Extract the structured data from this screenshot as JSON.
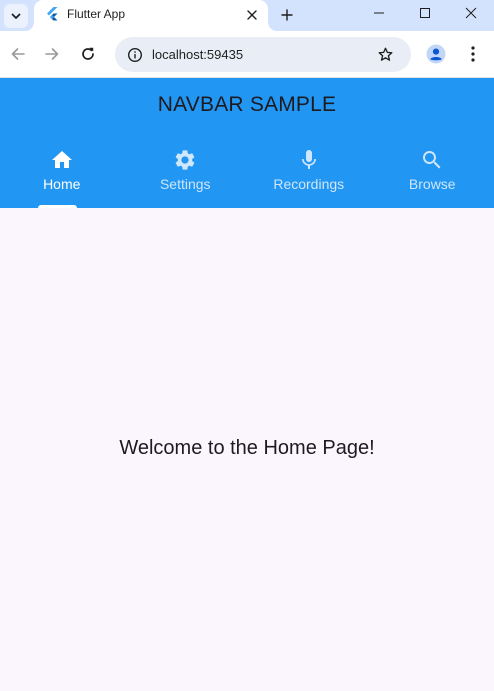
{
  "browser": {
    "tab": {
      "title": "Flutter App"
    },
    "new_tab_symbol": "+",
    "address_bar": {
      "url": "localhost:59435"
    },
    "icons": {
      "tab_search": "chevron-down-icon",
      "favicon": "flutter-logo-icon",
      "tab_close": "close-icon",
      "new_tab": "plus-icon",
      "minimize": "minimize-icon",
      "maximize": "maximize-icon",
      "window_close": "close-icon",
      "back": "arrow-back-icon",
      "forward": "arrow-forward-icon",
      "reload": "reload-icon",
      "site_info": "info-icon",
      "bookmark": "star-icon",
      "profile": "profile-icon",
      "menu": "kebab-menu-icon"
    }
  },
  "appbar": {
    "title": "NAVBAR SAMPLE",
    "background_color": "#2196f3",
    "tabs": [
      {
        "label": "Home",
        "icon": "home-icon",
        "selected": true
      },
      {
        "label": "Settings",
        "icon": "settings-icon",
        "selected": false
      },
      {
        "label": "Recordings",
        "icon": "mic-icon",
        "selected": false
      },
      {
        "label": "Browse",
        "icon": "search-icon",
        "selected": false
      }
    ]
  },
  "main": {
    "message": "Welcome to the Home Page!",
    "background_color": "#fbf6fe"
  }
}
